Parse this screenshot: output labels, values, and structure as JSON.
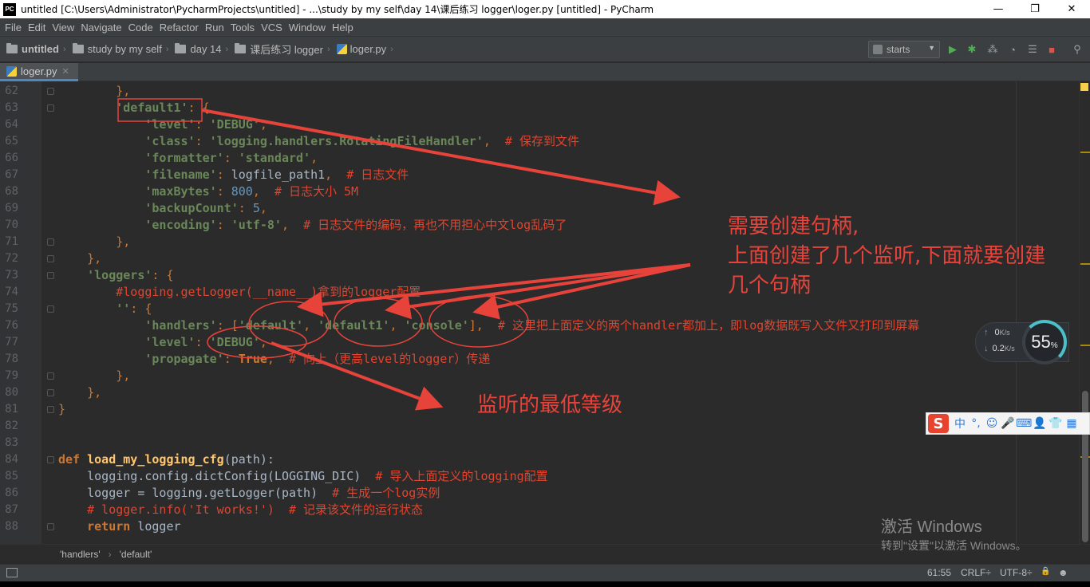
{
  "window": {
    "title": "untitled [C:\\Users\\Administrator\\PycharmProjects\\untitled] - ...\\study by my self\\day 14\\课后练习 logger\\loger.py [untitled] - PyCharm",
    "app_icon_text": "PC",
    "minimize": "—",
    "restore": "❐",
    "close": "✕"
  },
  "menu": [
    "File",
    "Edit",
    "View",
    "Navigate",
    "Code",
    "Refactor",
    "Run",
    "Tools",
    "VCS",
    "Window",
    "Help"
  ],
  "breadcrumbs": [
    "untitled",
    "study by my self",
    "day 14",
    "课后练习 logger",
    "loger.py"
  ],
  "run_config": {
    "label": "starts",
    "dropdown": "▼"
  },
  "toolbar_icons": [
    {
      "name": "run-icon",
      "glyph": "▶",
      "color": "#4caf50"
    },
    {
      "name": "debug-icon",
      "glyph": "✱",
      "color": "#4caf50"
    },
    {
      "name": "coverage-icon",
      "glyph": "⁂",
      "color": "#9aa0a4"
    },
    {
      "name": "profile-icon",
      "glyph": "◔",
      "color": "#9aa0a4"
    },
    {
      "name": "concurrency-icon",
      "glyph": "☰",
      "color": "#9aa0a4"
    },
    {
      "name": "stop-icon",
      "glyph": "■",
      "color": "#d9534f"
    },
    {
      "name": "search-everywhere-icon",
      "glyph": "⚲",
      "color": "#9aa0a4"
    }
  ],
  "tab": {
    "label": "loger.py",
    "close": "✕"
  },
  "code_lines": [
    {
      "n": "62",
      "tokens": [
        [
          "pun",
          "        },"
        ]
      ]
    },
    {
      "n": "63",
      "tokens": [
        [
          "str",
          "        'default1'"
        ],
        [
          "pun",
          ": {"
        ]
      ]
    },
    {
      "n": "64",
      "tokens": [
        [
          "str",
          "            'level'"
        ],
        [
          "pun",
          ": "
        ],
        [
          "str",
          "'DEBUG'"
        ],
        [
          "pun",
          ","
        ]
      ]
    },
    {
      "n": "65",
      "tokens": [
        [
          "str",
          "            'class'"
        ],
        [
          "pun",
          ": "
        ],
        [
          "str",
          "'logging.handlers.RotatingFileHandler'"
        ],
        [
          "pun",
          ",  "
        ],
        [
          "cmt-red",
          "# 保存到文件"
        ]
      ]
    },
    {
      "n": "66",
      "tokens": [
        [
          "str",
          "            'formatter'"
        ],
        [
          "pun",
          ": "
        ],
        [
          "str",
          "'standard'"
        ],
        [
          "pun",
          ","
        ]
      ]
    },
    {
      "n": "67",
      "tokens": [
        [
          "str",
          "            'filename'"
        ],
        [
          "pun",
          ": "
        ],
        [
          "id",
          "logfile_path1"
        ],
        [
          "pun",
          ",  "
        ],
        [
          "cmt-red",
          "# 日志文件"
        ]
      ]
    },
    {
      "n": "68",
      "tokens": [
        [
          "str",
          "            'maxBytes'"
        ],
        [
          "pun",
          ": "
        ],
        [
          "num",
          "800"
        ],
        [
          "pun",
          ",  "
        ],
        [
          "cmt-red",
          "# 日志大小 5M"
        ]
      ]
    },
    {
      "n": "69",
      "tokens": [
        [
          "str",
          "            'backupCount'"
        ],
        [
          "pun",
          ": "
        ],
        [
          "num",
          "5"
        ],
        [
          "pun",
          ","
        ]
      ]
    },
    {
      "n": "70",
      "tokens": [
        [
          "str",
          "            'encoding'"
        ],
        [
          "pun",
          ": "
        ],
        [
          "str",
          "'utf-8'"
        ],
        [
          "pun",
          ",  "
        ],
        [
          "cmt-red",
          "# 日志文件的编码，再也不用担心中文log乱码了"
        ]
      ]
    },
    {
      "n": "71",
      "tokens": [
        [
          "pun",
          "        },"
        ]
      ]
    },
    {
      "n": "72",
      "tokens": [
        [
          "pun",
          "    },"
        ]
      ]
    },
    {
      "n": "73",
      "tokens": [
        [
          "str",
          "    'loggers'"
        ],
        [
          "pun",
          ": {"
        ]
      ]
    },
    {
      "n": "74",
      "tokens": [
        [
          "cmt-red",
          "        #logging.getLogger(__name__)拿到的logger配置"
        ]
      ]
    },
    {
      "n": "75",
      "tokens": [
        [
          "str",
          "        ''"
        ],
        [
          "pun",
          ": {"
        ]
      ]
    },
    {
      "n": "76",
      "tokens": [
        [
          "str",
          "            'handlers'"
        ],
        [
          "pun",
          ": ["
        ],
        [
          "str",
          "'default'"
        ],
        [
          "pun",
          ", "
        ],
        [
          "str",
          "'default1'"
        ],
        [
          "pun",
          ", "
        ],
        [
          "str",
          "'console'"
        ],
        [
          "pun",
          "],  "
        ],
        [
          "cmt-red",
          "# 这里把上面定义的两个handler都加上，即log数据既写入文件又打印到屏幕"
        ]
      ]
    },
    {
      "n": "77",
      "tokens": [
        [
          "str",
          "            'level'"
        ],
        [
          "pun",
          ": "
        ],
        [
          "str",
          "'DEBUG'"
        ],
        [
          "pun",
          ","
        ]
      ]
    },
    {
      "n": "78",
      "tokens": [
        [
          "str",
          "            'propagate'"
        ],
        [
          "pun",
          ": "
        ],
        [
          "true",
          "True"
        ],
        [
          "pun",
          ",  "
        ],
        [
          "cmt-red",
          "# 向上（更高level的logger）传递"
        ]
      ]
    },
    {
      "n": "79",
      "tokens": [
        [
          "pun",
          "        },"
        ]
      ]
    },
    {
      "n": "80",
      "tokens": [
        [
          "pun",
          "    },"
        ]
      ]
    },
    {
      "n": "81",
      "tokens": [
        [
          "pun",
          "}"
        ]
      ]
    },
    {
      "n": "82",
      "tokens": []
    },
    {
      "n": "83",
      "tokens": []
    },
    {
      "n": "84",
      "tokens": [
        [
          "kw",
          "def "
        ],
        [
          "fn",
          "load_my_logging_cfg"
        ],
        [
          "id",
          "(path):"
        ]
      ]
    },
    {
      "n": "85",
      "tokens": [
        [
          "id",
          "    logging.config.dictConfig(LOGGING_DIC)  "
        ],
        [
          "cmt-red",
          "# 导入上面定义的logging配置"
        ]
      ]
    },
    {
      "n": "86",
      "tokens": [
        [
          "id",
          "    logger = logging.getLogger(path)  "
        ],
        [
          "cmt-red",
          "# 生成一个log实例"
        ]
      ]
    },
    {
      "n": "87",
      "tokens": [
        [
          "cmt-red",
          "    # logger.info('It works!')  # 记录该文件的运行状态"
        ]
      ]
    },
    {
      "n": "88",
      "tokens": [
        [
          "kw",
          "    return "
        ],
        [
          "id",
          "logger"
        ]
      ]
    }
  ],
  "annotations": {
    "handle_note_line1": "需要创建句柄,",
    "handle_note_line2": "上面创建了几个监听,下面就要创建",
    "handle_note_line3": "几个句柄",
    "level_note": "监听的最低等级"
  },
  "editor_breadcrumb": [
    "'handlers'",
    "'default'"
  ],
  "editor_breadcrumb_sep": "›",
  "status": {
    "position": "61:55",
    "line_sep": "CRLF÷",
    "encoding": "UTF-8÷",
    "lock_icon": "🔒",
    "inspector_icon": "☻"
  },
  "watermark": {
    "title": "激活 Windows",
    "subtitle": "转到\"设置\"以激活 Windows。"
  },
  "net_widget": {
    "up_arrow": "↑",
    "up_value": "0",
    "up_unit": "K/s",
    "down_arrow": "↓",
    "down_value": "0.2",
    "down_unit": "K/s",
    "percent": "55",
    "percent_sign": "%"
  },
  "ime_bar": {
    "logo": "S",
    "items": [
      "中",
      "°,",
      "☺",
      "🎤",
      "⌨",
      "👤",
      "👕",
      "▦"
    ]
  }
}
